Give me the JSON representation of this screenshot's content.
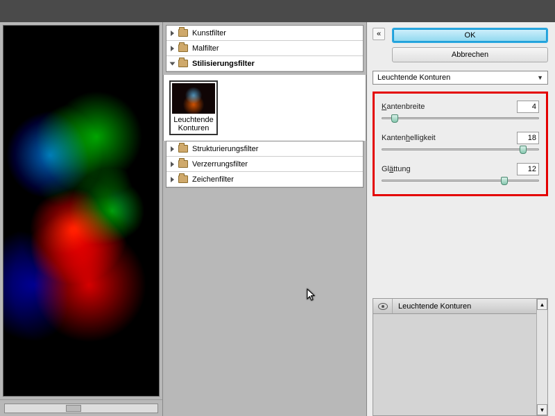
{
  "buttons": {
    "ok": "OK",
    "cancel": "Abbrechen"
  },
  "dropdown": {
    "selected": "Leuchtende Konturen"
  },
  "filter_tree": {
    "items": [
      {
        "label": "Kunstfilter",
        "expanded": false
      },
      {
        "label": "Malfilter",
        "expanded": false
      },
      {
        "label": "Stilisierungsfilter",
        "expanded": true
      },
      {
        "label": "Strukturierungsfilter",
        "expanded": false
      },
      {
        "label": "Verzerrungsfilter",
        "expanded": false
      },
      {
        "label": "Zeichenfilter",
        "expanded": false
      }
    ],
    "thumb_label_line1": "Leuchtende",
    "thumb_label_line2": "Konturen"
  },
  "sliders": {
    "kantenbreite": {
      "label": "Kantenbreite",
      "underline_char": "K",
      "rest": "antenbreite",
      "value": "4",
      "pos_pct": 8
    },
    "kantenhelligkeit": {
      "label": "Kantenhelligkeit",
      "underline_char": "h",
      "prefix": "Kanten",
      "rest": "elligkeit",
      "value": "18",
      "pos_pct": 90
    },
    "glaettung": {
      "label": "Glättung",
      "underline_char": "ä",
      "prefix": "Gl",
      "rest": "ttung",
      "value": "12",
      "pos_pct": 78
    }
  },
  "layers": {
    "row_label": "Leuchtende Konturen"
  }
}
